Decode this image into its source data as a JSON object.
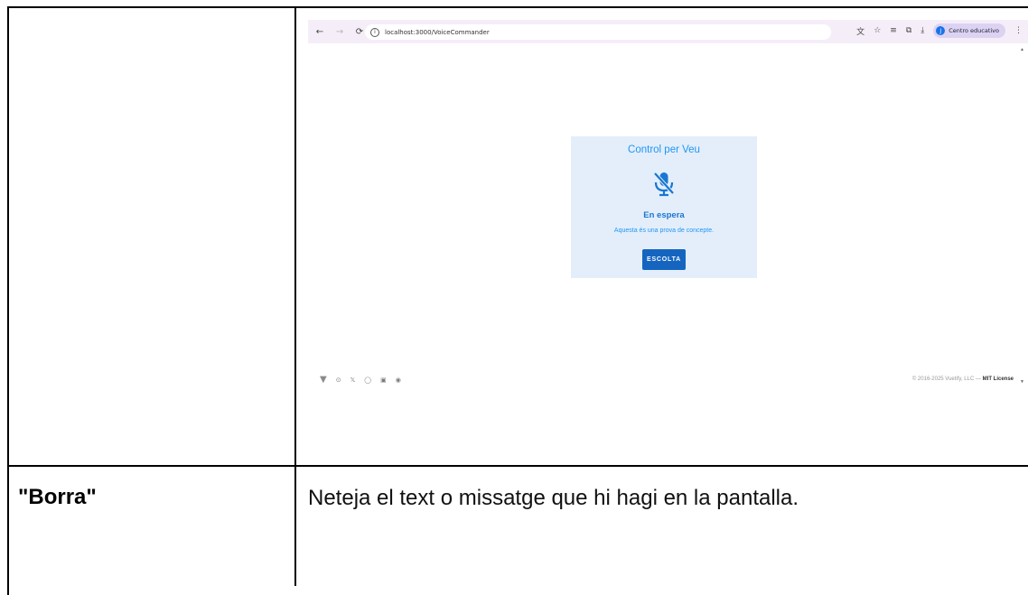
{
  "browser": {
    "url": "localhost:3000/VoiceCommander",
    "profile_label": "Centro educativo",
    "profile_initial": "J",
    "icons": {
      "back": "arrow-left-icon",
      "forward": "arrow-right-icon",
      "reload": "reload-icon",
      "site_info": "info-icon",
      "translate": "translate-icon",
      "bookmark": "star-icon",
      "tab_search": "tab-list-icon",
      "extensions": "puzzle-icon",
      "download": "download-icon",
      "menu": "kebab-icon"
    }
  },
  "card": {
    "title": "Control per Veu",
    "status_title": "En espera",
    "status_subtitle": "Aquesta és una prova de concepte.",
    "button_label": "ESCOLTA",
    "mic_icon": "mic-off-icon"
  },
  "footer": {
    "copyright": "© 2016-2025 Vuetify, LLC —",
    "license": "MIT License",
    "icons": [
      "vuetify-logo-icon",
      "store-icon",
      "x-icon",
      "github-icon",
      "discord-icon",
      "reddit-icon"
    ]
  },
  "row": {
    "term": "\"Borra\"",
    "description": "Neteja el text o missatge que hi hagi en la pantalla."
  },
  "colors": {
    "card_bg": "#e3eefa",
    "accent": "#2196f3",
    "button": "#1565c0",
    "chrome_bar": "#f5eef9"
  }
}
